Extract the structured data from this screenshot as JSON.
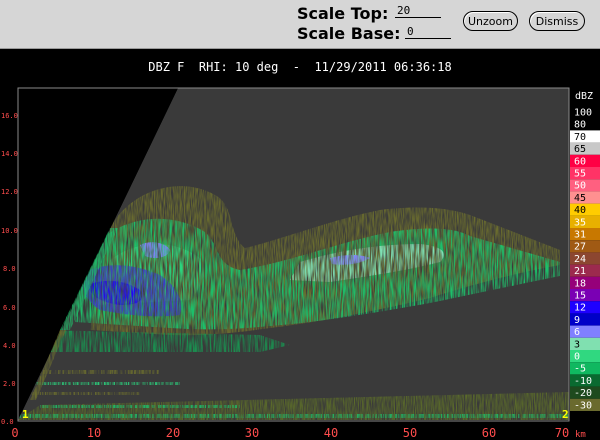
{
  "toolbar": {
    "scale_top_label": "Scale Top:",
    "scale_top_value": "20",
    "scale_base_label": "Scale Base:",
    "scale_base_value": "0",
    "unzoom_label": "Unzoom",
    "dismiss_label": "Dismiss"
  },
  "plot": {
    "title": "DBZ F  RHI: 10 deg  -  11/29/2011 06:36:18",
    "x_ticks": [
      "0",
      "10",
      "20",
      "30",
      "40",
      "50",
      "60",
      "70"
    ],
    "x_unit": "km",
    "y_ticks": [
      "0.0",
      "2.0",
      "4.0",
      "6.0",
      "8.0",
      "10.0",
      "12.0",
      "14.0",
      "16.0"
    ],
    "corner_markers": [
      "1",
      "2"
    ]
  },
  "colorbar": {
    "title": "dBZ",
    "entries": [
      {
        "label": "100",
        "color": "#000000"
      },
      {
        "label": "80",
        "color": "#000000"
      },
      {
        "label": "70",
        "color": "#ffffff"
      },
      {
        "label": "65",
        "color": "#c8c8c8"
      },
      {
        "label": "60",
        "color": "#ff0044"
      },
      {
        "label": "55",
        "color": "#ff3366"
      },
      {
        "label": "50",
        "color": "#ff6080"
      },
      {
        "label": "45",
        "color": "#ff9090"
      },
      {
        "label": "40",
        "color": "#ffcc00"
      },
      {
        "label": "35",
        "color": "#e8b000"
      },
      {
        "label": "31",
        "color": "#c87800"
      },
      {
        "label": "27",
        "color": "#a05a14"
      },
      {
        "label": "24",
        "color": "#8c4630"
      },
      {
        "label": "21",
        "color": "#9c2a4e"
      },
      {
        "label": "18",
        "color": "#96007a"
      },
      {
        "label": "15",
        "color": "#7a00b4"
      },
      {
        "label": "12",
        "color": "#1e00ff"
      },
      {
        "label": "9",
        "color": "#0000c8"
      },
      {
        "label": "6",
        "color": "#8080ff"
      },
      {
        "label": "3",
        "color": "#80e0b0"
      },
      {
        "label": "0",
        "color": "#30d880"
      },
      {
        "label": "-5",
        "color": "#10b860"
      },
      {
        "label": "-10",
        "color": "#0a6a30"
      },
      {
        "label": "-20",
        "color": "#1e4a1e"
      },
      {
        "label": "-30",
        "color": "#6a6a2e"
      }
    ]
  },
  "colors": {
    "background": "#000000",
    "plot_area": "#3a3a3a",
    "tick_labels": "#ff4d4d",
    "corner_markers": "#ffff00"
  }
}
